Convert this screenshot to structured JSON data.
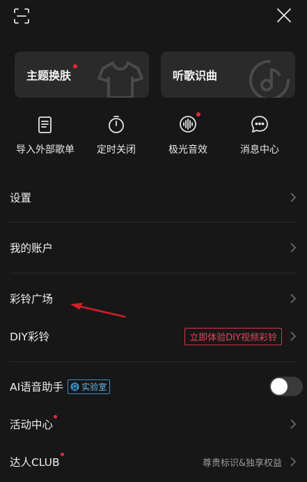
{
  "header": {
    "scan_icon": "scan-icon",
    "close_icon": "close-icon"
  },
  "cards": {
    "theme_label": "主题换肤",
    "song_label": "听歌识曲"
  },
  "quick": [
    {
      "label": "导入外部歌单",
      "icon": "import-playlist-icon"
    },
    {
      "label": "定时关闭",
      "icon": "timer-icon"
    },
    {
      "label": "极光音效",
      "icon": "audio-effect-icon"
    },
    {
      "label": "消息中心",
      "icon": "message-icon"
    }
  ],
  "menu": {
    "settings": "设置",
    "account": "我的账户",
    "ringtone_plaza": "彩铃广场",
    "diy_ringtone": "DIY彩铃",
    "diy_promo": "立即体验DIY视频彩铃",
    "ai_assistant": "AI语音助手",
    "lab_badge": "实验室",
    "activity_center": "活动中心",
    "club": "达人CLUB",
    "club_desc": "尊贵标识&独享权益"
  },
  "colors": {
    "background": "#171717",
    "card": "#2a2a2a",
    "red_dot": "#e8283a",
    "promo_red": "#e5455b",
    "lab_blue": "#6db6e8"
  }
}
